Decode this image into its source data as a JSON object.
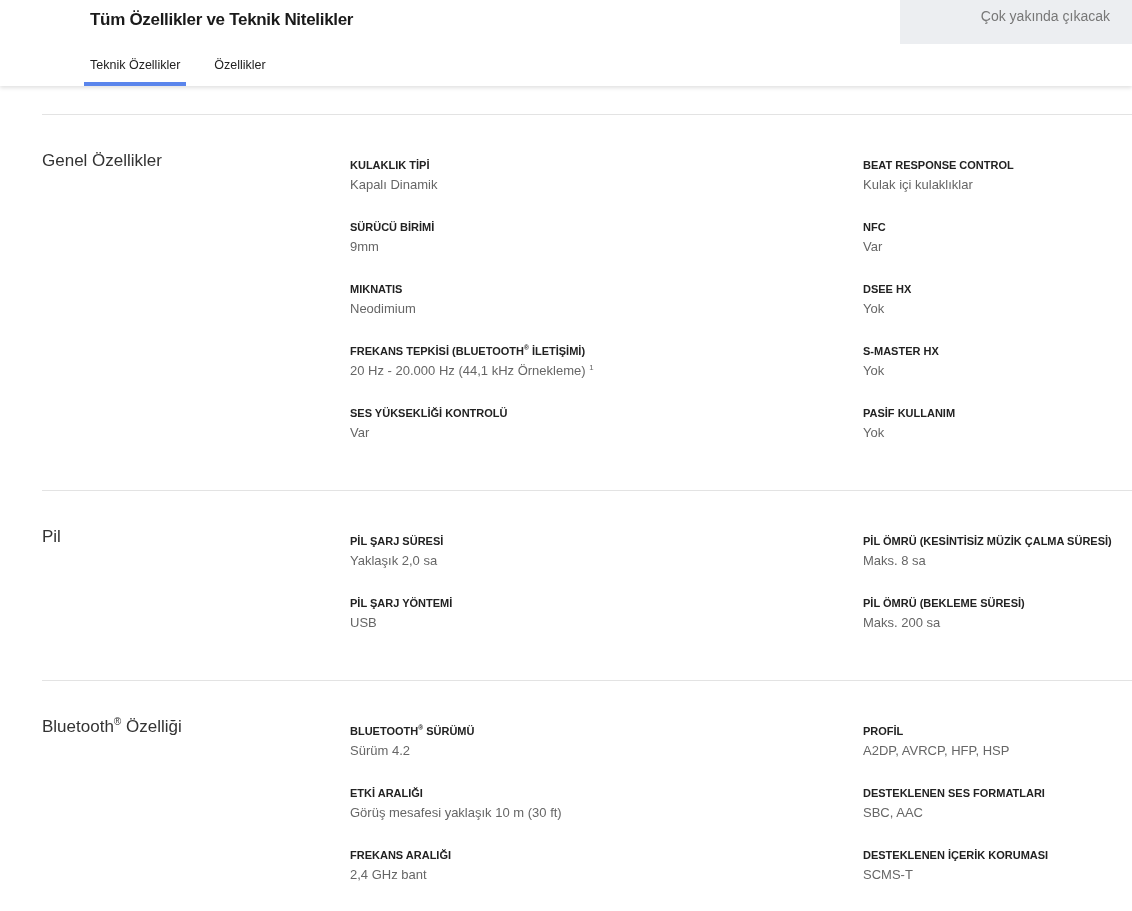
{
  "header": {
    "title": "Tüm Özellikler ve Teknik Nitelikler",
    "button": "Çok yakında çıkacak"
  },
  "tabs": [
    {
      "label": "Teknik Özellikler",
      "selected": true
    },
    {
      "label": "Özellikler",
      "selected": false
    }
  ],
  "sections": [
    {
      "title": "Genel Özellikler",
      "left": [
        {
          "label": "KULAKLIK TİPİ",
          "value": "Kapalı Dinamik"
        },
        {
          "label": "SÜRÜCÜ BİRİMİ",
          "value": "9mm"
        },
        {
          "label": "MIKNATIS",
          "value": "Neodimium"
        },
        {
          "label": "FREKANS TEPKİSİ (BLUETOOTH$^{®}$ İLETİŞİMİ)",
          "value": "20 Hz - 20.000 Hz (44,1 kHz Örnekleme) $^{1}$"
        },
        {
          "label": "SES YÜKSEKLİĞİ KONTROLÜ",
          "value": "Var"
        }
      ],
      "right": [
        {
          "label": "BEAT RESPONSE CONTROL",
          "value": "Kulak içi kulaklıklar"
        },
        {
          "label": "NFC",
          "value": "Var"
        },
        {
          "label": "DSEE HX",
          "value": "Yok"
        },
        {
          "label": "S-MASTER HX",
          "value": "Yok"
        },
        {
          "label": "PASİF KULLANIM",
          "value": "Yok"
        }
      ]
    },
    {
      "title": "Pil",
      "left": [
        {
          "label": "PİL ŞARJ SÜRESİ",
          "value": "Yaklaşık 2,0 sa"
        },
        {
          "label": "PİL ŞARJ YÖNTEMİ",
          "value": "USB"
        }
      ],
      "right": [
        {
          "label": "PİL ÖMRÜ (KESİNTİSİZ MÜZİK ÇALMA SÜRESİ)",
          "value": "Maks. 8 sa"
        },
        {
          "label": "PİL ÖMRÜ (BEKLEME SÜRESİ)",
          "value": "Maks. 200 sa"
        }
      ]
    },
    {
      "title": "Bluetooth$^{®}$ Özelliği",
      "left": [
        {
          "label": "BLUETOOTH$^{®}$ SÜRÜMÜ",
          "value": "Sürüm 4.2"
        },
        {
          "label": "ETKİ ARALIĞI",
          "value": "Görüş mesafesi yaklaşık 10 m (30 ft)"
        },
        {
          "label": "FREKANS ARALIĞI",
          "value": "2,4 GHz bant"
        }
      ],
      "right": [
        {
          "label": "PROFİL",
          "value": "A2DP, AVRCP, HFP, HSP"
        },
        {
          "label": "DESTEKLENEN SES FORMATLARI",
          "value": "SBC, AAC"
        },
        {
          "label": "DESTEKLENEN İÇERİK KORUMASI",
          "value": "SCMS-T"
        }
      ]
    }
  ]
}
